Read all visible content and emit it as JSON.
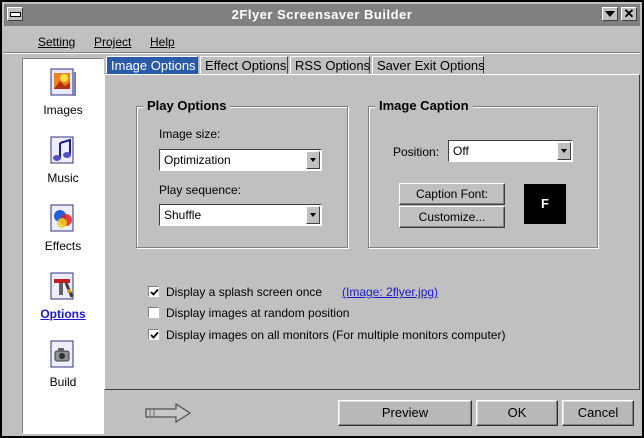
{
  "window": {
    "title": "2Flyer Screensaver Builder"
  },
  "menu": {
    "items": [
      "Setting",
      "Project",
      "Help"
    ]
  },
  "sidebar": {
    "items": [
      {
        "label": "Images",
        "icon": "images-icon"
      },
      {
        "label": "Music",
        "icon": "music-note-icon"
      },
      {
        "label": "Effects",
        "icon": "effects-icon"
      },
      {
        "label": "Options",
        "icon": "options-tools-icon",
        "active": true
      },
      {
        "label": "Build",
        "icon": "build-icon"
      }
    ]
  },
  "tabs": [
    {
      "label": "Image Options",
      "active": true
    },
    {
      "label": "Effect Options"
    },
    {
      "label": "RSS Options"
    },
    {
      "label": "Saver Exit Options"
    }
  ],
  "play_options": {
    "title": "Play Options",
    "image_size_label": "Image size:",
    "image_size_value": "Optimization",
    "play_sequence_label": "Play sequence:",
    "play_sequence_value": "Shuffle"
  },
  "image_caption": {
    "title": "Image Caption",
    "position_label": "Position:",
    "position_value": "Off",
    "caption_font_button": "Caption Font:",
    "customize_button": "Customize...",
    "font_preview": "F"
  },
  "checkboxes": [
    {
      "label": "Display a splash screen once",
      "checked": true
    },
    {
      "label": "Display images at random position",
      "checked": false
    },
    {
      "label": "Display images on all monitors (For multiple monitors computer)",
      "checked": true
    }
  ],
  "splash_link": "(Image: 2flyer.jpg)",
  "buttons": {
    "preview": "Preview",
    "ok": "OK",
    "cancel": "Cancel"
  },
  "colors": {
    "active_tab": "#2a5ba8",
    "link": "#1a1acc",
    "titlebar": "#808080"
  }
}
